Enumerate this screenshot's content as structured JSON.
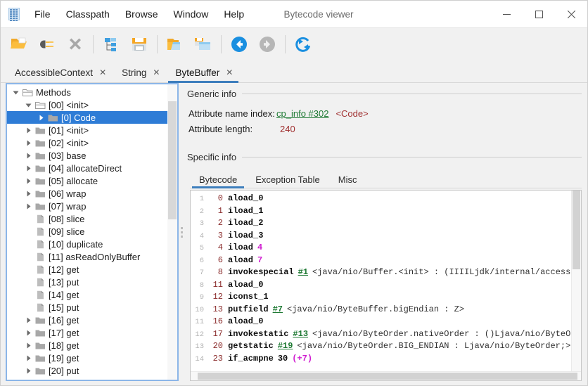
{
  "window": {
    "title": "Bytecode viewer",
    "app_icon": "grid-icon",
    "minimize_label": "minimize-icon",
    "maximize_label": "maximize-icon",
    "close_label": "close-icon"
  },
  "menubar": {
    "items": [
      {
        "label": "File"
      },
      {
        "label": "Classpath"
      },
      {
        "label": "Browse"
      },
      {
        "label": "Window"
      },
      {
        "label": "Help"
      }
    ]
  },
  "toolbar": {
    "buttons": [
      {
        "name": "open-folder-icon",
        "title": "Open"
      },
      {
        "name": "plug-icon",
        "title": "Open from classpath"
      },
      {
        "name": "close-x-icon",
        "title": "Close"
      },
      {
        "name": "tree-icon",
        "title": "Browse tree"
      },
      {
        "name": "save-icon",
        "title": "Save"
      },
      {
        "name": "open-window-icon",
        "title": "Open window"
      },
      {
        "name": "save-window-icon",
        "title": "Save window"
      },
      {
        "name": "back-arrow-icon",
        "title": "Back"
      },
      {
        "name": "forward-arrow-icon",
        "title": "Forward"
      },
      {
        "name": "reload-icon",
        "title": "Reload"
      }
    ]
  },
  "tabs": {
    "items": [
      {
        "label": "AccessibleContext",
        "active": false,
        "close": "✕"
      },
      {
        "label": "String",
        "active": false,
        "close": "✕"
      },
      {
        "label": "ByteBuffer",
        "active": true,
        "close": "✕"
      }
    ]
  },
  "tree": {
    "nodes": [
      {
        "label": "Methods",
        "depth": 0,
        "twist": "down",
        "icon": "folder-open",
        "selected": false
      },
      {
        "label": "[00] <init>",
        "depth": 1,
        "twist": "down",
        "icon": "folder-open",
        "selected": false
      },
      {
        "label": "[0] Code",
        "depth": 2,
        "twist": "right",
        "icon": "folder-closed",
        "selected": true
      },
      {
        "label": "[01] <init>",
        "depth": 1,
        "twist": "right",
        "icon": "folder-closed",
        "selected": false
      },
      {
        "label": "[02] <init>",
        "depth": 1,
        "twist": "right",
        "icon": "folder-closed",
        "selected": false
      },
      {
        "label": "[03] base",
        "depth": 1,
        "twist": "right",
        "icon": "folder-closed",
        "selected": false
      },
      {
        "label": "[04] allocateDirect",
        "depth": 1,
        "twist": "right",
        "icon": "folder-closed",
        "selected": false
      },
      {
        "label": "[05] allocate",
        "depth": 1,
        "twist": "right",
        "icon": "folder-closed",
        "selected": false
      },
      {
        "label": "[06] wrap",
        "depth": 1,
        "twist": "right",
        "icon": "folder-closed",
        "selected": false
      },
      {
        "label": "[07] wrap",
        "depth": 1,
        "twist": "right",
        "icon": "folder-closed",
        "selected": false
      },
      {
        "label": "[08] slice",
        "depth": 1,
        "twist": "none",
        "icon": "file",
        "selected": false
      },
      {
        "label": "[09] slice",
        "depth": 1,
        "twist": "none",
        "icon": "file",
        "selected": false
      },
      {
        "label": "[10] duplicate",
        "depth": 1,
        "twist": "none",
        "icon": "file",
        "selected": false
      },
      {
        "label": "[11] asReadOnlyBuffer",
        "depth": 1,
        "twist": "none",
        "icon": "file",
        "selected": false
      },
      {
        "label": "[12] get",
        "depth": 1,
        "twist": "none",
        "icon": "file",
        "selected": false
      },
      {
        "label": "[13] put",
        "depth": 1,
        "twist": "none",
        "icon": "file",
        "selected": false
      },
      {
        "label": "[14] get",
        "depth": 1,
        "twist": "none",
        "icon": "file",
        "selected": false
      },
      {
        "label": "[15] put",
        "depth": 1,
        "twist": "none",
        "icon": "file",
        "selected": false
      },
      {
        "label": "[16] get",
        "depth": 1,
        "twist": "right",
        "icon": "folder-closed",
        "selected": false
      },
      {
        "label": "[17] get",
        "depth": 1,
        "twist": "right",
        "icon": "folder-closed",
        "selected": false
      },
      {
        "label": "[18] get",
        "depth": 1,
        "twist": "right",
        "icon": "folder-closed",
        "selected": false
      },
      {
        "label": "[19] get",
        "depth": 1,
        "twist": "right",
        "icon": "folder-closed",
        "selected": false
      },
      {
        "label": "[20] put",
        "depth": 1,
        "twist": "right",
        "icon": "folder-closed",
        "selected": false
      }
    ]
  },
  "detail": {
    "generic_info_title": "Generic info",
    "specific_info_title": "Specific info",
    "attribute_name_index_label": "Attribute name index:",
    "attribute_name_index_link": "cp_info #302",
    "attribute_name_index_value": "<Code>",
    "attribute_length_label": "Attribute length:",
    "attribute_length_value": "240",
    "subtabs": [
      {
        "label": "Bytecode",
        "active": true
      },
      {
        "label": "Exception Table",
        "active": false
      },
      {
        "label": "Misc",
        "active": false
      }
    ]
  },
  "bytecode": {
    "lines": [
      {
        "ln": "1",
        "offset": "0",
        "op": "aload_0",
        "imm": "",
        "ref": "",
        "desc": ""
      },
      {
        "ln": "2",
        "offset": "1",
        "op": "iload_1",
        "imm": "",
        "ref": "",
        "desc": ""
      },
      {
        "ln": "3",
        "offset": "2",
        "op": "iload_2",
        "imm": "",
        "ref": "",
        "desc": ""
      },
      {
        "ln": "4",
        "offset": "3",
        "op": "iload_3",
        "imm": "",
        "ref": "",
        "desc": ""
      },
      {
        "ln": "5",
        "offset": "4",
        "op": "iload",
        "imm": "4",
        "ref": "",
        "desc": ""
      },
      {
        "ln": "6",
        "offset": "6",
        "op": "aload",
        "imm": "7",
        "ref": "",
        "desc": ""
      },
      {
        "ln": "7",
        "offset": "8",
        "op": "invokespecial",
        "imm": "",
        "ref": "#1",
        "desc": "<java/nio/Buffer.<init> : (IIIILjdk/internal/access/forei"
      },
      {
        "ln": "8",
        "offset": "11",
        "op": "aload_0",
        "imm": "",
        "ref": "",
        "desc": ""
      },
      {
        "ln": "9",
        "offset": "12",
        "op": "iconst_1",
        "imm": "",
        "ref": "",
        "desc": ""
      },
      {
        "ln": "10",
        "offset": "13",
        "op": "putfield",
        "imm": "",
        "ref": "#7",
        "desc": "<java/nio/ByteBuffer.bigEndian : Z>"
      },
      {
        "ln": "11",
        "offset": "16",
        "op": "aload_0",
        "imm": "",
        "ref": "",
        "desc": ""
      },
      {
        "ln": "12",
        "offset": "17",
        "op": "invokestatic",
        "imm": "",
        "ref": "#13",
        "desc": "<java/nio/ByteOrder.nativeOrder : ()Ljava/nio/ByteOrder;>"
      },
      {
        "ln": "13",
        "offset": "20",
        "op": "getstatic",
        "imm": "",
        "ref": "#19",
        "desc": "<java/nio/ByteOrder.BIG_ENDIAN : Ljava/nio/ByteOrder;>"
      },
      {
        "ln": "14",
        "offset": "23",
        "op": "if_acmpne",
        "imm": "",
        "ref": "",
        "branch": "30",
        "branch_delta": "(+7)",
        "desc": ""
      }
    ]
  },
  "colors": {
    "accent": "#3d7ebd",
    "selection": "#2e7cd6",
    "link_green": "#1f7a34",
    "value_red": "#a03030",
    "immediate_magenta": "#d01cd0",
    "panel_bg": "#f1f1f1"
  }
}
